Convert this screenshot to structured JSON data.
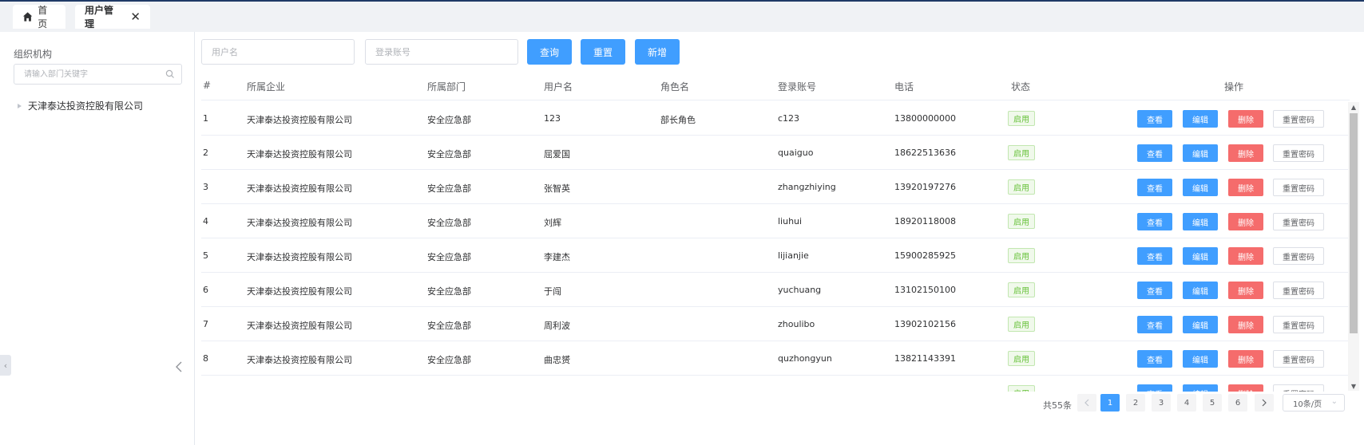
{
  "tabs": {
    "home_label": "首页",
    "users_label": "用户管理"
  },
  "sidebar": {
    "title": "组织机构",
    "search_placeholder": "请输入部门关键字",
    "tree_root": "天津泰达投资控股有限公司"
  },
  "filters": {
    "username_placeholder": "用户名",
    "account_placeholder": "登录账号",
    "query_label": "查询",
    "reset_label": "重置",
    "add_label": "新增"
  },
  "table": {
    "headers": [
      "#",
      "所属企业",
      "所属部门",
      "用户名",
      "角色名",
      "登录账号",
      "电话",
      "状态",
      "操作"
    ],
    "op_labels": {
      "view": "查看",
      "edit": "编辑",
      "delete": "删除",
      "reset_pwd": "重置密码"
    },
    "rows": [
      {
        "idx": "1",
        "company": "天津泰达投资控股有限公司",
        "dept": "安全应急部",
        "username": "123",
        "role": "部长角色",
        "account": "c123",
        "phone": "13800000000",
        "status": "启用"
      },
      {
        "idx": "2",
        "company": "天津泰达投资控股有限公司",
        "dept": "安全应急部",
        "username": "屈爱国",
        "role": "",
        "account": "quaiguo",
        "phone": "18622513636",
        "status": "启用"
      },
      {
        "idx": "3",
        "company": "天津泰达投资控股有限公司",
        "dept": "安全应急部",
        "username": "张智英",
        "role": "",
        "account": "zhangzhiying",
        "phone": "13920197276",
        "status": "启用"
      },
      {
        "idx": "4",
        "company": "天津泰达投资控股有限公司",
        "dept": "安全应急部",
        "username": "刘辉",
        "role": "",
        "account": "liuhui",
        "phone": "18920118008",
        "status": "启用"
      },
      {
        "idx": "5",
        "company": "天津泰达投资控股有限公司",
        "dept": "安全应急部",
        "username": "李建杰",
        "role": "",
        "account": "lijianjie",
        "phone": "15900285925",
        "status": "启用"
      },
      {
        "idx": "6",
        "company": "天津泰达投资控股有限公司",
        "dept": "安全应急部",
        "username": "于闯",
        "role": "",
        "account": "yuchuang",
        "phone": "13102150100",
        "status": "启用"
      },
      {
        "idx": "7",
        "company": "天津泰达投资控股有限公司",
        "dept": "安全应急部",
        "username": "周利波",
        "role": "",
        "account": "zhoulibo",
        "phone": "13902102156",
        "status": "启用"
      },
      {
        "idx": "8",
        "company": "天津泰达投资控股有限公司",
        "dept": "安全应急部",
        "username": "曲忠赟",
        "role": "",
        "account": "quzhongyun",
        "phone": "13821143391",
        "status": "启用"
      },
      {
        "idx": "",
        "company": "",
        "dept": "",
        "username": "",
        "role": "",
        "account": "",
        "phone": "",
        "status": "启用"
      }
    ]
  },
  "pagination": {
    "total_label": "共55条",
    "pages": [
      "1",
      "2",
      "3",
      "4",
      "5",
      "6"
    ],
    "current": "1",
    "page_size_label": "10条/页",
    "prev_icon": "chevron-left",
    "next_icon": "chevron-right"
  },
  "colors": {
    "primary": "#409eff",
    "danger": "#f56c6c",
    "success": "#67c23a"
  }
}
